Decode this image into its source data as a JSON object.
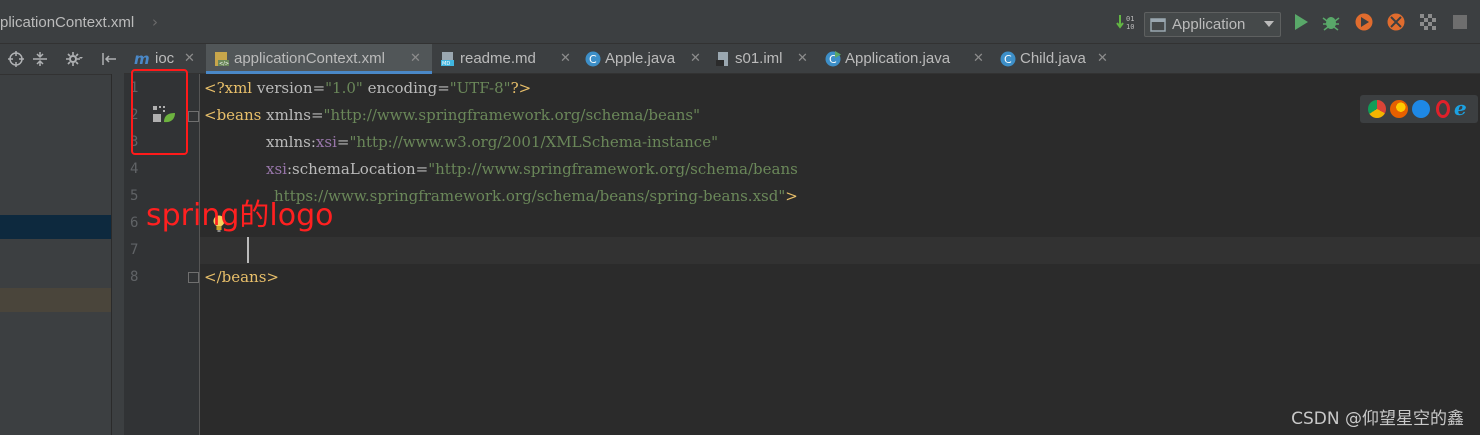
{
  "breadcrumb": {
    "file": "plicationContext.xml"
  },
  "run_config": {
    "label": "Application"
  },
  "tabs": [
    {
      "label": "ioc",
      "icon": "module-icon",
      "active": false
    },
    {
      "label": "applicationContext.xml",
      "icon": "spring-xml-icon",
      "active": true
    },
    {
      "label": "readme.md",
      "icon": "markdown-icon",
      "active": false
    },
    {
      "label": "Apple.java",
      "icon": "class-icon",
      "active": false
    },
    {
      "label": "s01.iml",
      "icon": "iml-file-icon",
      "active": false
    },
    {
      "label": "Application.java",
      "icon": "class-run-icon",
      "active": false
    },
    {
      "label": "Child.java",
      "icon": "class-icon",
      "active": false
    }
  ],
  "line_numbers": [
    "1",
    "2",
    "3",
    "4",
    "5",
    "6",
    "7",
    "8"
  ],
  "code": {
    "l1_open": "<?xml ",
    "l1_a1": "version=",
    "l1_v1": "\"1.0\"",
    "l1_a2": " encoding=",
    "l1_v2": "\"UTF-8\"",
    "l1_close": "?>",
    "l2_tag": "<beans ",
    "l2_attr": "xmlns=",
    "l2_val": "\"http://www.springframework.org/schema/beans\"",
    "l3_attr": "xmlns:",
    "l3_ns": "xsi",
    "l3_eq": "=",
    "l3_val": "\"http://www.w3.org/2001/XMLSchema-instance\"",
    "l4_ns": "xsi",
    "l4_attr": ":schemaLocation=",
    "l4_val": "\"http://www.springframework.org/schema/beans",
    "l5_val": "https://www.springframework.org/schema/beans/spring-beans.xsd\"",
    "l5_close": ">",
    "l8_tag": "</beans>"
  },
  "annotation": {
    "text": "spring的logo"
  },
  "watermark": "CSDN @仰望星空的鑫",
  "colors": {
    "annotation": "#ff1a1a",
    "active_tab_underline": "#4a88c7",
    "xml_tag": "#e8bf6a",
    "xml_string": "#6a8759",
    "xml_namespace": "#9876aa"
  }
}
